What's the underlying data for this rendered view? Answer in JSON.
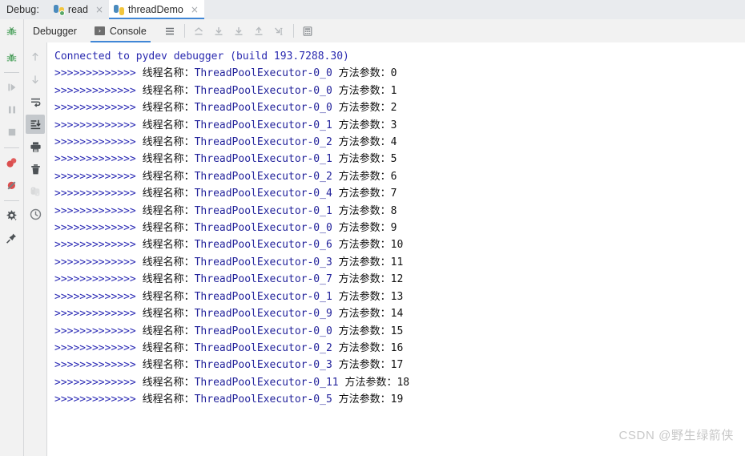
{
  "window": {
    "debug_label": "Debug:",
    "file_tabs": [
      {
        "label": "read",
        "icon": "python-file-icon",
        "active": false,
        "running": true,
        "close": "×"
      },
      {
        "label": "threadDemo",
        "icon": "python-file-icon",
        "active": true,
        "running": false,
        "close": "×"
      }
    ]
  },
  "toolbar": {
    "bug_icon": "debug-bug-icon",
    "tabs": [
      {
        "label": "Debugger",
        "active": false
      },
      {
        "label": "Console",
        "active": true,
        "icon": "console-terminal-icon"
      }
    ],
    "buttons": [
      {
        "name": "soft-wrap-icon",
        "enabled": true
      },
      {
        "name": "step-out-up-icon",
        "enabled": false
      },
      {
        "name": "step-into-down-icon",
        "enabled": false
      },
      {
        "name": "force-step-into-down-icon",
        "enabled": false
      },
      {
        "name": "step-out-icon",
        "enabled": false
      },
      {
        "name": "run-to-cursor-icon",
        "enabled": false
      },
      {
        "name": "evaluate-expression-icon",
        "enabled": false
      }
    ]
  },
  "rail_primary": [
    {
      "name": "debug-bug-icon",
      "enabled": true
    },
    {
      "name": "resume-program-icon",
      "enabled": false
    },
    {
      "name": "pause-program-icon",
      "enabled": false
    },
    {
      "name": "stop-program-icon",
      "enabled": false
    },
    {
      "name": "view-breakpoints-icon",
      "enabled": true
    },
    {
      "name": "mute-breakpoints-icon",
      "enabled": true
    },
    {
      "name": "settings-gear-icon",
      "enabled": true
    },
    {
      "name": "pin-tab-icon",
      "enabled": true
    }
  ],
  "rail_secondary": [
    {
      "name": "scroll-up-icon",
      "enabled": false
    },
    {
      "name": "scroll-down-icon",
      "enabled": false
    },
    {
      "name": "soft-wrap-lines-icon",
      "enabled": true
    },
    {
      "name": "scroll-to-end-icon",
      "enabled": true,
      "selected": true
    },
    {
      "name": "print-icon",
      "enabled": true
    },
    {
      "name": "clear-all-trash-icon",
      "enabled": true
    },
    {
      "name": "python-console-icon",
      "enabled": false
    },
    {
      "name": "history-clock-icon",
      "enabled": true
    }
  ],
  "console": {
    "connected_line": "Connected to pydev debugger (build 193.7288.30)",
    "arrows": ">>>>>>>>>>>>>",
    "thread_label": "线程名称：",
    "arg_label": "方法参数：",
    "rows": [
      {
        "thread": "ThreadPoolExecutor-0_0",
        "arg": "0"
      },
      {
        "thread": "ThreadPoolExecutor-0_0",
        "arg": "1"
      },
      {
        "thread": "ThreadPoolExecutor-0_0",
        "arg": "2"
      },
      {
        "thread": "ThreadPoolExecutor-0_1",
        "arg": "3"
      },
      {
        "thread": "ThreadPoolExecutor-0_2",
        "arg": "4"
      },
      {
        "thread": "ThreadPoolExecutor-0_1",
        "arg": "5"
      },
      {
        "thread": "ThreadPoolExecutor-0_2",
        "arg": "6"
      },
      {
        "thread": "ThreadPoolExecutor-0_4",
        "arg": "7"
      },
      {
        "thread": "ThreadPoolExecutor-0_1",
        "arg": "8"
      },
      {
        "thread": "ThreadPoolExecutor-0_0",
        "arg": "9"
      },
      {
        "thread": "ThreadPoolExecutor-0_6",
        "arg": "10"
      },
      {
        "thread": "ThreadPoolExecutor-0_3",
        "arg": "11"
      },
      {
        "thread": "ThreadPoolExecutor-0_7",
        "arg": "12"
      },
      {
        "thread": "ThreadPoolExecutor-0_1",
        "arg": "13"
      },
      {
        "thread": "ThreadPoolExecutor-0_9",
        "arg": "14"
      },
      {
        "thread": "ThreadPoolExecutor-0_0",
        "arg": "15"
      },
      {
        "thread": "ThreadPoolExecutor-0_2",
        "arg": "16"
      },
      {
        "thread": "ThreadPoolExecutor-0_3",
        "arg": "17"
      },
      {
        "thread": "ThreadPoolExecutor-0_11",
        "arg": "18"
      },
      {
        "thread": "ThreadPoolExecutor-0_5",
        "arg": "19"
      }
    ]
  },
  "watermark": "CSDN @野生绿箭侠",
  "colors": {
    "accent": "#4187d6",
    "console_text": "#0c0cb4",
    "chrome": "#f2f2f2",
    "tabstrip": "#e9ebee",
    "bug_green": "#59a869",
    "breakpoint_red": "#db5c5c"
  }
}
